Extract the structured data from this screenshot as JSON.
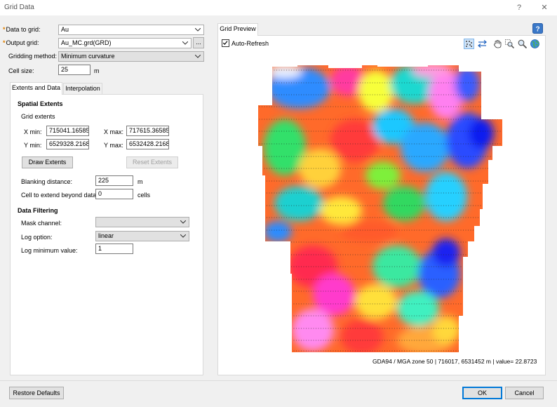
{
  "window": {
    "title": "Grid Data",
    "help_label": "?",
    "close_label": "✕"
  },
  "form": {
    "data_to_grid_label": "Data to grid:",
    "data_to_grid_value": "Au",
    "output_grid_label": "Output grid:",
    "output_grid_value": "Au_MC.grd(GRD)",
    "browse_label": "...",
    "gridding_method_label": "Gridding method:",
    "gridding_method_value": "Minimum curvature",
    "cell_size_label": "Cell size:",
    "cell_size_value": "25",
    "cell_size_unit": "m"
  },
  "tabs": {
    "extents": "Extents and Data",
    "interpolation": "Interpolation"
  },
  "extents": {
    "section_title": "Spatial Extents",
    "group_label": "Grid extents",
    "xmin_label": "X min:",
    "xmin_value": "715041.16585",
    "xmax_label": "X max:",
    "xmax_value": "717615.36585",
    "ymin_label": "Y min:",
    "ymin_value": "6529328.2168",
    "ymax_label": "Y max:",
    "ymax_value": "6532428.2168",
    "draw_button": "Draw Extents",
    "reset_button": "Reset Extents",
    "blanking_label": "Blanking distance:",
    "blanking_value": "225",
    "blanking_unit": "m",
    "extend_label": "Cell to extend beyond data:",
    "extend_value": "0",
    "extend_unit": "cells"
  },
  "filtering": {
    "section_title": "Data Filtering",
    "mask_label": "Mask channel:",
    "mask_value": "",
    "log_option_label": "Log option:",
    "log_option_value": "linear",
    "log_min_label": "Log minimum value:",
    "log_min_value": "1"
  },
  "preview": {
    "tab_label": "Grid Preview",
    "auto_refresh_label": "Auto-Refresh",
    "auto_refresh_checked": true,
    "status": "GDA94 / MGA zone 50 |  716017, 6531452 m |  value= 22.8723",
    "tools": [
      "dots-icon",
      "stretch-icon",
      "pan-hand-icon",
      "zoom-region-icon",
      "zoom-icon",
      "globe-icon"
    ]
  },
  "footer": {
    "restore_button": "Restore Defaults",
    "ok_button": "OK",
    "cancel_button": "Cancel"
  },
  "colors": {
    "accent": "#0078d7",
    "required_marker": "#e08000",
    "help_icon": "#3a78c8"
  }
}
